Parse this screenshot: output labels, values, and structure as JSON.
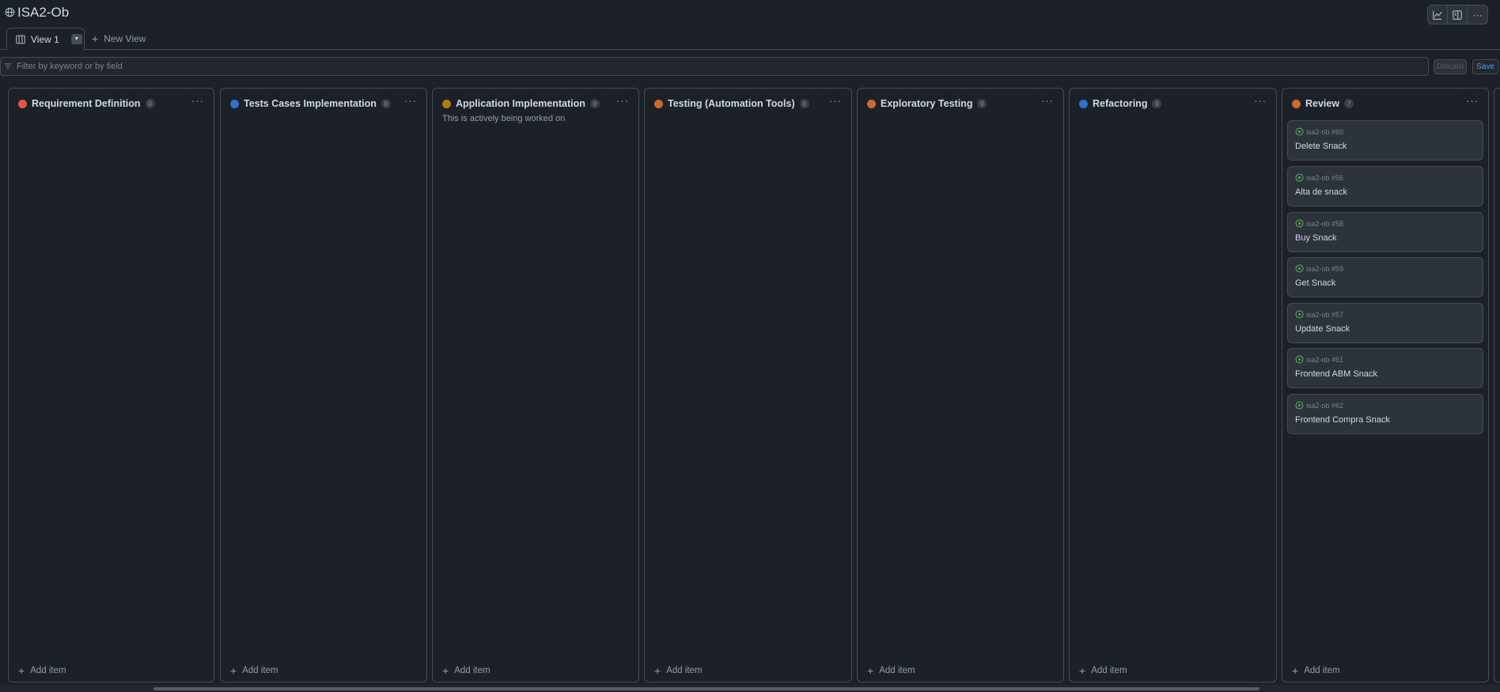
{
  "header": {
    "title": "ISA2-Ob"
  },
  "tabs": {
    "active_label": "View 1",
    "new_label": "New View"
  },
  "filter": {
    "placeholder": "Filter by keyword or by field",
    "discard_label": "Discard",
    "save_label": "Save"
  },
  "columns": [
    {
      "name": "Requirement Definition",
      "count": "0",
      "color": "#e5534b",
      "add_label": "Add item"
    },
    {
      "name": "Tests Cases Implementation",
      "count": "0",
      "color": "#316dca",
      "add_label": "Add item"
    },
    {
      "name": "Application Implementation",
      "count": "0",
      "color": "#ae7c14",
      "description": "This is actively being worked on",
      "add_label": "Add item"
    },
    {
      "name": "Testing (Automation Tools)",
      "count": "0",
      "color": "#cc6b2c",
      "add_label": "Add item"
    },
    {
      "name": "Exploratory Testing",
      "count": "0",
      "color": "#cc6b2c",
      "add_label": "Add item"
    },
    {
      "name": "Refactoring",
      "count": "0",
      "color": "#316dca",
      "add_label": "Add item"
    },
    {
      "name": "Review",
      "count": "7",
      "color": "#cc6b2c",
      "add_label": "Add item",
      "cards": [
        {
          "ref": "isa2-ob #60",
          "title": "Delete Snack"
        },
        {
          "ref": "isa2-ob #56",
          "title": "Alta de snack"
        },
        {
          "ref": "isa2-ob #58",
          "title": "Buy Snack"
        },
        {
          "ref": "isa2-ob #59",
          "title": "Get Snack"
        },
        {
          "ref": "isa2-ob #57",
          "title": "Update Snack"
        },
        {
          "ref": "isa2-ob #61",
          "title": "Frontend ABM Snack"
        },
        {
          "ref": "isa2-ob #62",
          "title": "Frontend Compra Snack"
        }
      ]
    }
  ],
  "colors": {
    "card_icon": "#57ab5a",
    "accent": "#539bf5"
  },
  "icons": [
    "globe-icon",
    "chart-icon",
    "panel-icon",
    "more-icon",
    "board-icon",
    "plus-icon",
    "filter-icon",
    "issue-open-icon"
  ]
}
